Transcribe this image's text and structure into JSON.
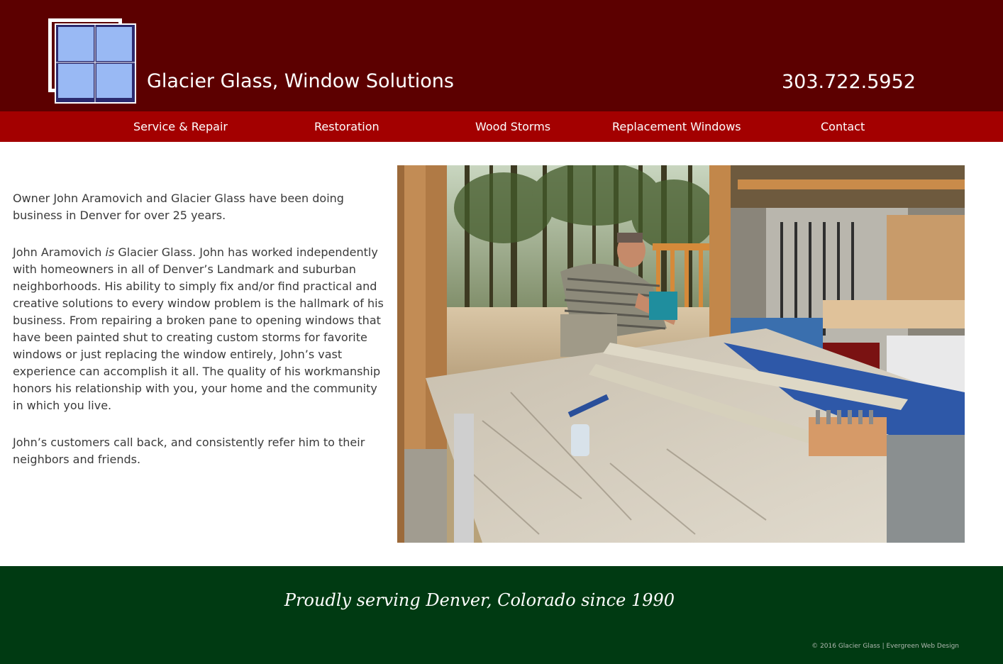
{
  "header": {
    "title": "Glacier Glass, Window Solutions",
    "phone": "303.722.5952",
    "logo_icon": "window-icon",
    "colors": {
      "header_bg": "#5c0000",
      "nav_bg": "#a30000",
      "footer_bg": "#003a12"
    }
  },
  "nav": {
    "items": [
      {
        "label": "Service & Repair"
      },
      {
        "label": "Restoration"
      },
      {
        "label": "Wood Storms"
      },
      {
        "label": "Replacement Windows"
      },
      {
        "label": "Contact"
      }
    ]
  },
  "main": {
    "paragraph_1": "Owner John Aramovich and Glacier Glass have been doing business in Denver for over 25 years.",
    "paragraph_2_lead": "John Aramovich ",
    "paragraph_2_emphasis": "is",
    "paragraph_2_rest": " Glacier Glass. John has worked independently with homeowners in all of Denver’s Landmark and suburban neighborhoods. His ability to simply fix and/or find practical and creative solutions to every window problem is the hallmark of his business. From repairing a broken pane to opening windows that have been painted shut to creating custom storms for favorite windows or just replacing the window entirely, John’s vast experience can accomplish it all. The quality of his workmanship honors his relationship with you, your home and the community in which you live.",
    "paragraph_3": "John’s customers call back, and consistently refer him to their neighbors and friends.",
    "photo_icon": "workshop-photo"
  },
  "footer": {
    "tagline": "Proudly serving Denver, Colorado since 1990",
    "copyright": "© 2016 Glacier Glass | Evergreen Web Design"
  }
}
